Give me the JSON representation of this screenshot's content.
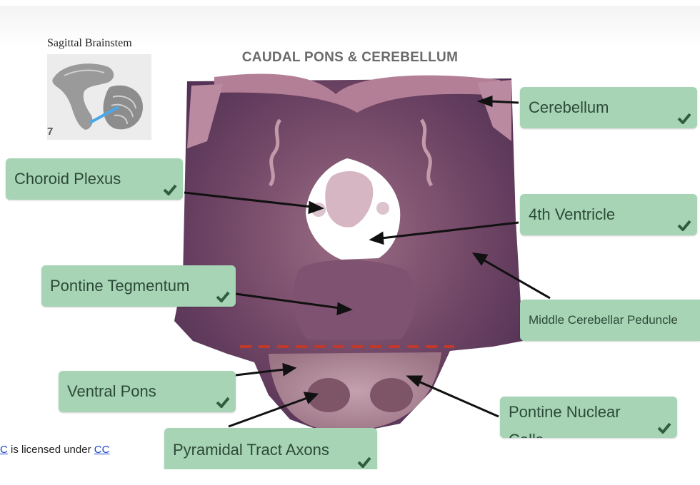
{
  "thumbnail": {
    "caption": "Sagittal Brainstem",
    "number": "7"
  },
  "title": "CAUDAL PONS & CEREBELLUM",
  "labels": {
    "cerebellum": "Cerebellum",
    "choroid_plexus": "Choroid Plexus",
    "fourth_ventricle": "4th Ventricle",
    "pontine_tegmentum": "Pontine Tegmentum",
    "middle_cerebellar_peduncle": "Middle Cerebellar Peduncle",
    "ventral_pons": "Ventral Pons",
    "pontine_nuclear_cells": "Pontine Nuclear Cells",
    "pyramidal_tract_axons": "Pyramidal Tract Axons"
  },
  "license": {
    "prefix_link": "C",
    "text": " is licensed under ",
    "link": "CC"
  },
  "colors": {
    "label_bg": "#a6d4b4",
    "check": "#2f5e3e",
    "divider": "#c0392b",
    "tissue": "#8a5a74"
  }
}
